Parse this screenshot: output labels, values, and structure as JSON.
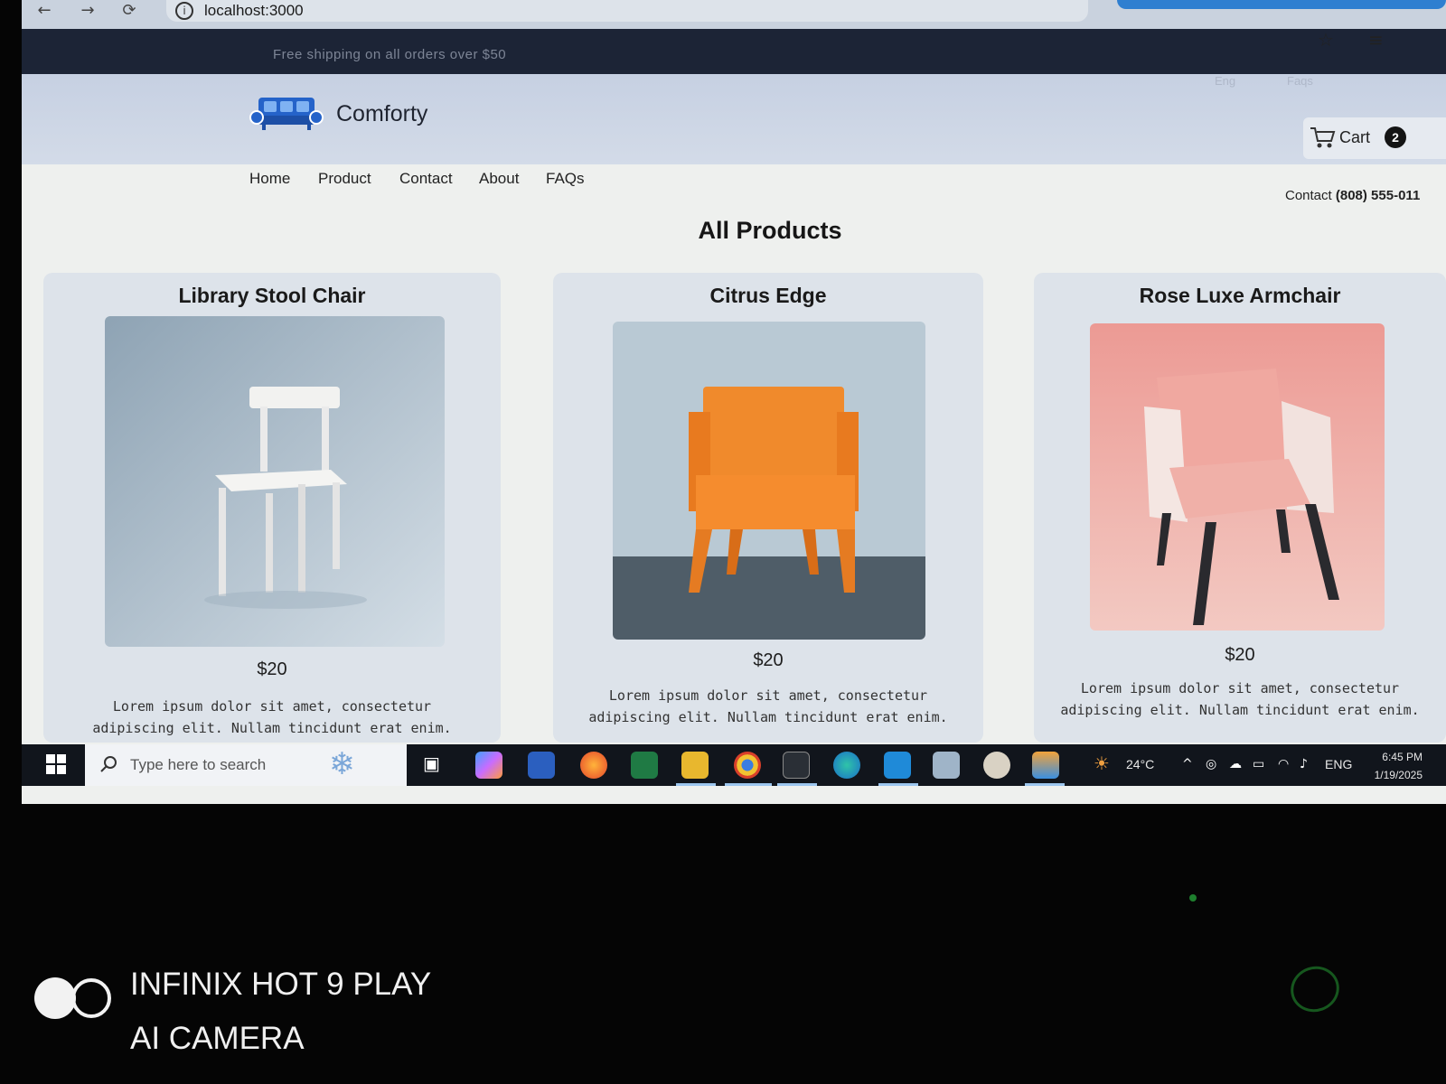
{
  "browser": {
    "url": "localhost:3000",
    "back_glyph": "←",
    "forward_glyph": "→",
    "reload_glyph": "⟳",
    "info_glyph": "i",
    "bookmark_glyph": "☆",
    "queue_glyph": "≡"
  },
  "announcement": {
    "text": "Free shipping on all orders over $50",
    "links": [
      "Eng",
      "Faqs"
    ]
  },
  "header": {
    "brand": "Comforty",
    "cart_label": "Cart",
    "cart_count": "2"
  },
  "nav": {
    "items": [
      "Home",
      "Product",
      "Contact",
      "About",
      "FAQs"
    ],
    "contact_prefix": "Contact",
    "contact_phone": "(808) 555-011"
  },
  "main": {
    "title": "All Products",
    "products": [
      {
        "name": "Library Stool Chair",
        "price": "$20",
        "desc_line1": "Lorem ipsum dolor sit amet, consectetur",
        "desc_line2": "adipiscing elit. Nullam tincidunt erat enim."
      },
      {
        "name": "Citrus Edge",
        "price": "$20",
        "desc_line1": "Lorem ipsum dolor sit amet, consectetur",
        "desc_line2": "adipiscing elit. Nullam tincidunt erat enim."
      },
      {
        "name": "Rose Luxe Armchair",
        "price": "$20",
        "desc_line1": "Lorem ipsum dolor sit amet, consectetur",
        "desc_line2": "adipiscing elit. Nullam tincidunt erat enim."
      }
    ]
  },
  "taskbar": {
    "search_placeholder": "Type here to search",
    "weather": "24°C",
    "language": "ENG",
    "time": "6:45 PM",
    "date": "1/19/2025",
    "apps": [
      "task-view",
      "copilot",
      "word",
      "firefox",
      "excel",
      "file-explorer",
      "chrome",
      "terminal",
      "edge",
      "vscode",
      "notepad",
      "paint",
      "app-launcher"
    ]
  },
  "camera_watermark": {
    "line1": "INFINIX HOT 9 PLAY",
    "line2": "AI CAMERA"
  },
  "colors": {
    "header_bg": "#c6d0e2",
    "announce_bg": "#1c2436",
    "card_bg": "#dde3ea",
    "taskbar_bg": "#11151c",
    "logo_blue": "#2563c9"
  }
}
